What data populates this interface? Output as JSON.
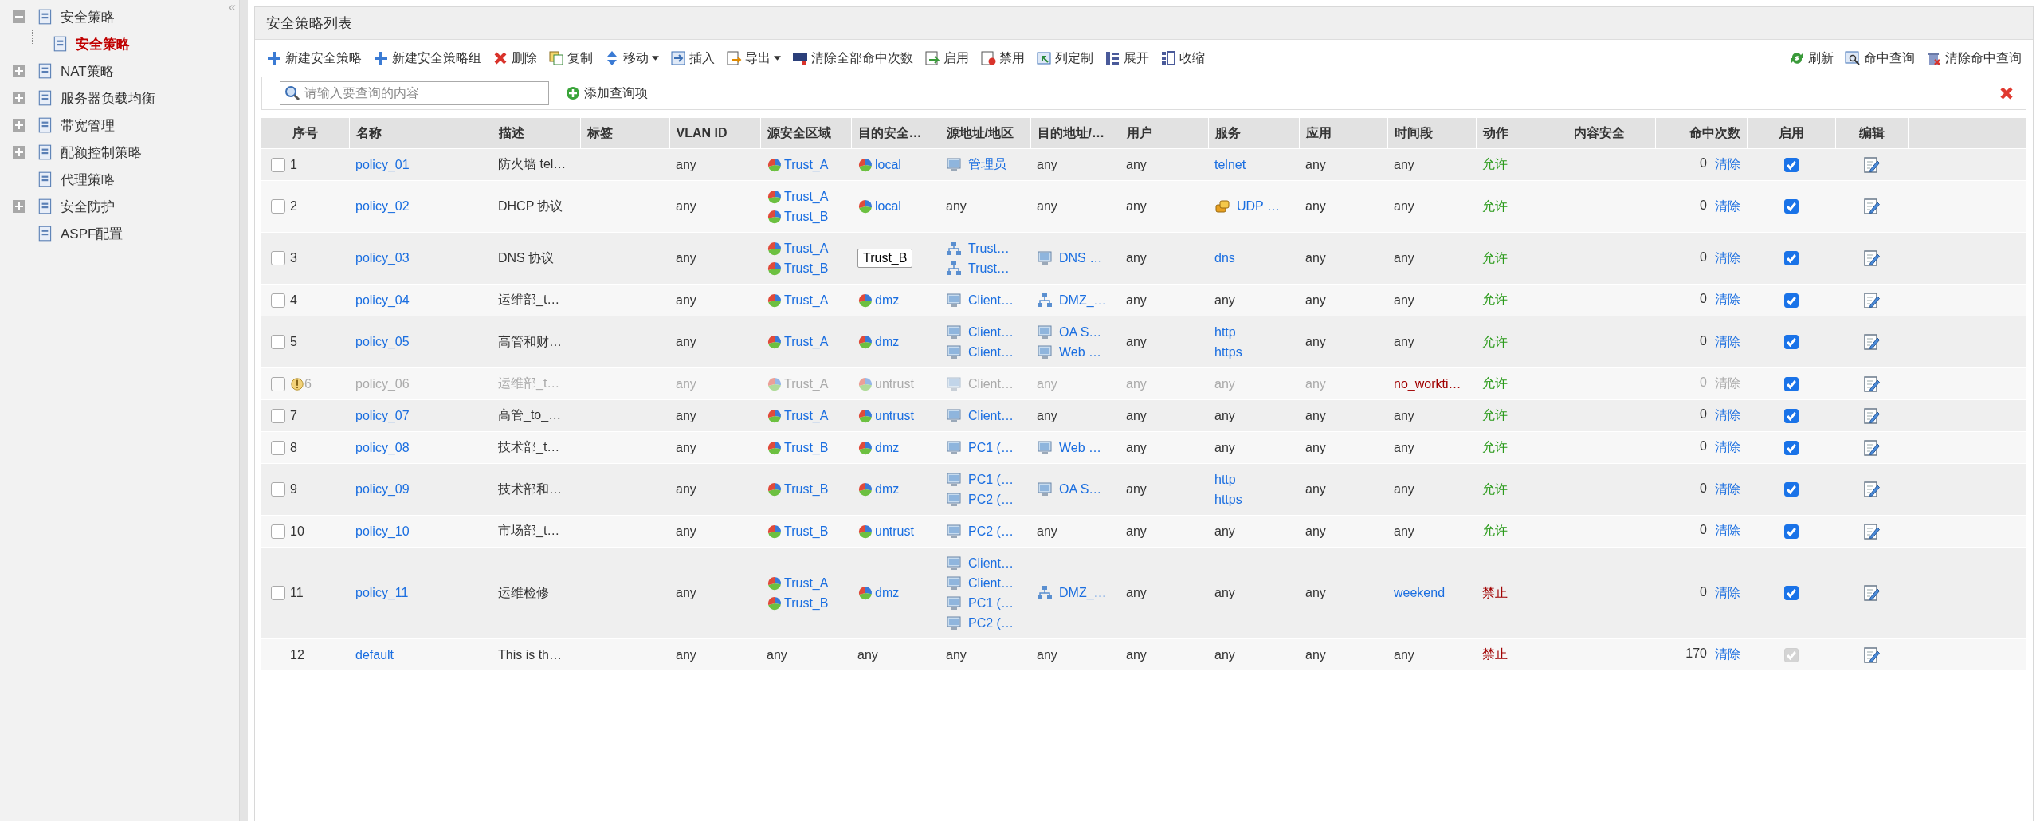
{
  "sidebar": {
    "collapse": "«",
    "items": [
      {
        "label": "安全策略",
        "kind": "group",
        "expanded": true,
        "selected": false,
        "children": [
          {
            "label": "安全策略",
            "selected": true
          }
        ]
      },
      {
        "label": "NAT策略",
        "kind": "group",
        "expanded": false,
        "selected": false
      },
      {
        "label": "服务器负载均衡",
        "kind": "group",
        "expanded": false,
        "selected": false
      },
      {
        "label": "带宽管理",
        "kind": "group",
        "expanded": false,
        "selected": false
      },
      {
        "label": "配额控制策略",
        "kind": "group",
        "expanded": false,
        "selected": false
      },
      {
        "label": "代理策略",
        "kind": "leaf",
        "selected": false
      },
      {
        "label": "安全防护",
        "kind": "group",
        "expanded": false,
        "selected": false
      },
      {
        "label": "ASPF配置",
        "kind": "leaf",
        "selected": false
      }
    ]
  },
  "panel": {
    "title": "安全策略列表"
  },
  "toolbar": {
    "left": [
      {
        "label": "新建安全策略",
        "kind": "add",
        "menu": false
      },
      {
        "label": "新建安全策略组",
        "kind": "add",
        "menu": false
      },
      {
        "label": "删除",
        "kind": "delete",
        "menu": false
      },
      {
        "label": "复制",
        "kind": "copy",
        "menu": false
      },
      {
        "label": "移动",
        "kind": "move",
        "menu": true
      },
      {
        "label": "插入",
        "kind": "insert",
        "menu": false
      },
      {
        "label": "导出",
        "kind": "export",
        "menu": true
      },
      {
        "label": "清除全部命中次数",
        "kind": "counter",
        "menu": false
      },
      {
        "label": "启用",
        "kind": "enable",
        "menu": false
      },
      {
        "label": "禁用",
        "kind": "disable",
        "menu": false
      },
      {
        "label": "列定制",
        "kind": "columns",
        "menu": false
      },
      {
        "label": "展开",
        "kind": "expand",
        "menu": false
      },
      {
        "label": "收缩",
        "kind": "collapse",
        "menu": false
      }
    ],
    "right": [
      {
        "label": "刷新",
        "kind": "refresh",
        "menu": false
      },
      {
        "label": "命中查询",
        "kind": "query",
        "menu": false
      },
      {
        "label": "清除命中查询",
        "kind": "clear-query",
        "menu": false
      }
    ]
  },
  "search": {
    "placeholder": "请输入要查询的内容",
    "add_button": "添加查询项"
  },
  "table": {
    "columns": [
      "序号",
      "名称",
      "描述",
      "标签",
      "VLAN ID",
      "源安全区域",
      "目的安全…",
      "源地址/地区",
      "目的地址/…",
      "用户",
      "服务",
      "应用",
      "时间段",
      "动作",
      "内容安全",
      "命中次数",
      "启用",
      "编辑"
    ],
    "rows": [
      {
        "number": "1",
        "kind": "policy",
        "selected": false,
        "inactive": false,
        "name": "policy_01",
        "description": "防火墙 tel…",
        "vlan": "any",
        "source_zone": [
          {
            "kind": "zone",
            "text": "Trust_A"
          }
        ],
        "destination_zone": [
          {
            "kind": "zone",
            "text": "local"
          }
        ],
        "source_address": [
          {
            "kind": "host",
            "text": "管理员"
          }
        ],
        "destination_address": [
          {
            "kind": "plain",
            "text": "any"
          }
        ],
        "user": "any",
        "service": [
          {
            "kind": "link",
            "text": "telnet"
          }
        ],
        "application": "any",
        "schedule": {
          "kind": "plain",
          "text": "any"
        },
        "action": {
          "kind": "allow",
          "text": "允许"
        },
        "hits": "0",
        "clear": "清除",
        "enabled": true
      },
      {
        "number": "2",
        "kind": "policy",
        "selected": false,
        "inactive": false,
        "name": "policy_02",
        "description": "DHCP 协议",
        "vlan": "any",
        "source_zone": [
          {
            "kind": "zone",
            "text": "Trust_A"
          },
          {
            "kind": "zone",
            "text": "Trust_B"
          }
        ],
        "destination_zone": [
          {
            "kind": "zone",
            "text": "local"
          }
        ],
        "source_address": [
          {
            "kind": "plain",
            "text": "any"
          }
        ],
        "destination_address": [
          {
            "kind": "plain",
            "text": "any"
          }
        ],
        "user": "any",
        "service": [
          {
            "kind": "service",
            "text": "UDP …"
          }
        ],
        "application": "any",
        "schedule": {
          "kind": "plain",
          "text": "any"
        },
        "action": {
          "kind": "allow",
          "text": "允许"
        },
        "hits": "0",
        "clear": "清除",
        "enabled": true
      },
      {
        "number": "3",
        "kind": "policy",
        "selected": false,
        "inactive": false,
        "name": "policy_03",
        "description": "DNS 协议",
        "vlan": "any",
        "source_zone": [
          {
            "kind": "zone",
            "text": "Trust_A"
          },
          {
            "kind": "zone",
            "text": "Trust_B"
          }
        ],
        "destination_zone": [
          {
            "kind": "tooltip",
            "text": "Trust_B"
          }
        ],
        "source_address": [
          {
            "kind": "net",
            "text": "Trust…"
          },
          {
            "kind": "net",
            "text": "Trust…"
          }
        ],
        "destination_address": [
          {
            "kind": "host",
            "text": "DNS …"
          }
        ],
        "user": "any",
        "service": [
          {
            "kind": "link",
            "text": "dns"
          }
        ],
        "application": "any",
        "schedule": {
          "kind": "plain",
          "text": "any"
        },
        "action": {
          "kind": "allow",
          "text": "允许"
        },
        "hits": "0",
        "clear": "清除",
        "enabled": true
      },
      {
        "number": "4",
        "kind": "policy",
        "selected": false,
        "inactive": false,
        "name": "policy_04",
        "description": "运维部_t…",
        "vlan": "any",
        "source_zone": [
          {
            "kind": "zone",
            "text": "Trust_A"
          }
        ],
        "destination_zone": [
          {
            "kind": "zone",
            "text": "dmz"
          }
        ],
        "source_address": [
          {
            "kind": "host",
            "text": "Client…"
          }
        ],
        "destination_address": [
          {
            "kind": "net",
            "text": "DMZ_…"
          }
        ],
        "user": "any",
        "service": [
          {
            "kind": "plain",
            "text": "any"
          }
        ],
        "application": "any",
        "schedule": {
          "kind": "plain",
          "text": "any"
        },
        "action": {
          "kind": "allow",
          "text": "允许"
        },
        "hits": "0",
        "clear": "清除",
        "enabled": true
      },
      {
        "number": "5",
        "kind": "policy",
        "selected": false,
        "inactive": false,
        "name": "policy_05",
        "description": "高管和财…",
        "vlan": "any",
        "source_zone": [
          {
            "kind": "zone",
            "text": "Trust_A"
          }
        ],
        "destination_zone": [
          {
            "kind": "zone",
            "text": "dmz"
          }
        ],
        "source_address": [
          {
            "kind": "host",
            "text": "Client…"
          },
          {
            "kind": "host",
            "text": "Client…"
          }
        ],
        "destination_address": [
          {
            "kind": "host",
            "text": "OA S…"
          },
          {
            "kind": "host",
            "text": "Web …"
          }
        ],
        "user": "any",
        "service": [
          {
            "kind": "link",
            "text": "http"
          },
          {
            "kind": "link",
            "text": "https"
          }
        ],
        "application": "any",
        "schedule": {
          "kind": "plain",
          "text": "any"
        },
        "action": {
          "kind": "allow",
          "text": "允许"
        },
        "hits": "0",
        "clear": "清除",
        "enabled": true
      },
      {
        "number": "6",
        "kind": "policy",
        "selected": false,
        "inactive": true,
        "name": "policy_06",
        "description": "运维部_t…",
        "vlan": "any",
        "source_zone": [
          {
            "kind": "zone",
            "text": "Trust_A"
          }
        ],
        "destination_zone": [
          {
            "kind": "zone",
            "text": "untrust"
          }
        ],
        "source_address": [
          {
            "kind": "host",
            "text": "Client…"
          }
        ],
        "destination_address": [
          {
            "kind": "plain",
            "text": "any"
          }
        ],
        "user": "any",
        "service": [
          {
            "kind": "plain",
            "text": "any"
          }
        ],
        "application": "any",
        "schedule": {
          "kind": "alert",
          "text": "no_workti…"
        },
        "action": {
          "kind": "allow",
          "text": "允许"
        },
        "hits": "0",
        "clear": "清除",
        "enabled": true
      },
      {
        "number": "7",
        "kind": "policy",
        "selected": false,
        "inactive": false,
        "name": "policy_07",
        "description": "高管_to_…",
        "vlan": "any",
        "source_zone": [
          {
            "kind": "zone",
            "text": "Trust_A"
          }
        ],
        "destination_zone": [
          {
            "kind": "zone",
            "text": "untrust"
          }
        ],
        "source_address": [
          {
            "kind": "host",
            "text": "Client…"
          }
        ],
        "destination_address": [
          {
            "kind": "plain",
            "text": "any"
          }
        ],
        "user": "any",
        "service": [
          {
            "kind": "plain",
            "text": "any"
          }
        ],
        "application": "any",
        "schedule": {
          "kind": "plain",
          "text": "any"
        },
        "action": {
          "kind": "allow",
          "text": "允许"
        },
        "hits": "0",
        "clear": "清除",
        "enabled": true
      },
      {
        "number": "8",
        "kind": "policy",
        "selected": false,
        "inactive": false,
        "name": "policy_08",
        "description": "技术部_t…",
        "vlan": "any",
        "source_zone": [
          {
            "kind": "zone",
            "text": "Trust_B"
          }
        ],
        "destination_zone": [
          {
            "kind": "zone",
            "text": "dmz"
          }
        ],
        "source_address": [
          {
            "kind": "host",
            "text": "PC1 (…"
          }
        ],
        "destination_address": [
          {
            "kind": "host",
            "text": "Web …"
          }
        ],
        "user": "any",
        "service": [
          {
            "kind": "plain",
            "text": "any"
          }
        ],
        "application": "any",
        "schedule": {
          "kind": "plain",
          "text": "any"
        },
        "action": {
          "kind": "allow",
          "text": "允许"
        },
        "hits": "0",
        "clear": "清除",
        "enabled": true
      },
      {
        "number": "9",
        "kind": "policy",
        "selected": false,
        "inactive": false,
        "name": "policy_09",
        "description": "技术部和…",
        "vlan": "any",
        "source_zone": [
          {
            "kind": "zone",
            "text": "Trust_B"
          }
        ],
        "destination_zone": [
          {
            "kind": "zone",
            "text": "dmz"
          }
        ],
        "source_address": [
          {
            "kind": "host",
            "text": "PC1 (…"
          },
          {
            "kind": "host",
            "text": "PC2 (…"
          }
        ],
        "destination_address": [
          {
            "kind": "host",
            "text": "OA S…"
          }
        ],
        "user": "any",
        "service": [
          {
            "kind": "link",
            "text": "http"
          },
          {
            "kind": "link",
            "text": "https"
          }
        ],
        "application": "any",
        "schedule": {
          "kind": "plain",
          "text": "any"
        },
        "action": {
          "kind": "allow",
          "text": "允许"
        },
        "hits": "0",
        "clear": "清除",
        "enabled": true
      },
      {
        "number": "10",
        "kind": "policy",
        "selected": false,
        "inactive": false,
        "name": "policy_10",
        "description": "市场部_t…",
        "vlan": "any",
        "source_zone": [
          {
            "kind": "zone",
            "text": "Trust_B"
          }
        ],
        "destination_zone": [
          {
            "kind": "zone",
            "text": "untrust"
          }
        ],
        "source_address": [
          {
            "kind": "host",
            "text": "PC2 (…"
          }
        ],
        "destination_address": [
          {
            "kind": "plain",
            "text": "any"
          }
        ],
        "user": "any",
        "service": [
          {
            "kind": "plain",
            "text": "any"
          }
        ],
        "application": "any",
        "schedule": {
          "kind": "plain",
          "text": "any"
        },
        "action": {
          "kind": "allow",
          "text": "允许"
        },
        "hits": "0",
        "clear": "清除",
        "enabled": true
      },
      {
        "number": "11",
        "kind": "policy",
        "selected": false,
        "inactive": false,
        "name": "policy_11",
        "description": "运维检修",
        "vlan": "any",
        "source_zone": [
          {
            "kind": "zone",
            "text": "Trust_A"
          },
          {
            "kind": "zone",
            "text": "Trust_B"
          }
        ],
        "destination_zone": [
          {
            "kind": "zone",
            "text": "dmz"
          }
        ],
        "source_address": [
          {
            "kind": "host",
            "text": "Client…"
          },
          {
            "kind": "host",
            "text": "Client…"
          },
          {
            "kind": "host",
            "text": "PC1 (…"
          },
          {
            "kind": "host",
            "text": "PC2 (…"
          }
        ],
        "destination_address": [
          {
            "kind": "net",
            "text": "DMZ_…"
          }
        ],
        "user": "any",
        "service": [
          {
            "kind": "plain",
            "text": "any"
          }
        ],
        "application": "any",
        "schedule": {
          "kind": "link",
          "text": "weekend"
        },
        "action": {
          "kind": "deny",
          "text": "禁止"
        },
        "hits": "0",
        "clear": "清除",
        "enabled": true
      },
      {
        "number": "12",
        "kind": "default",
        "inactive": false,
        "name": "default",
        "description": "This is th…",
        "vlan": "any",
        "source_zone": [
          {
            "kind": "plain",
            "text": "any"
          }
        ],
        "destination_zone": [
          {
            "kind": "plain",
            "text": "any"
          }
        ],
        "source_address": [
          {
            "kind": "plain",
            "text": "any"
          }
        ],
        "destination_address": [
          {
            "kind": "plain",
            "text": "any"
          }
        ],
        "user": "any",
        "service": [
          {
            "kind": "plain",
            "text": "any"
          }
        ],
        "application": "any",
        "schedule": {
          "kind": "plain",
          "text": "any"
        },
        "action": {
          "kind": "deny",
          "text": "禁止"
        },
        "hits": "170",
        "clear": "清除",
        "enabled": true
      }
    ]
  }
}
